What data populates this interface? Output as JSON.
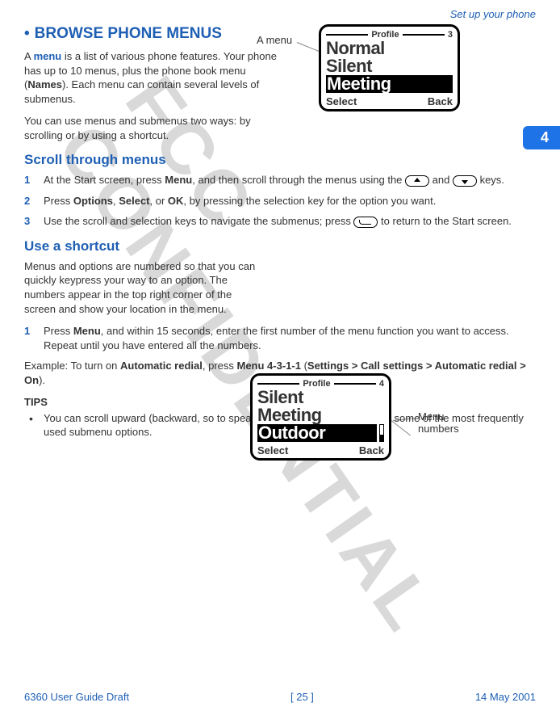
{
  "running_head": "Set up your phone",
  "tab_number": "4",
  "h1": "BROWSE PHONE MENUS",
  "intro": {
    "part1": "A ",
    "menu_word": "menu",
    "part2": " is a list of various phone features. Your phone has up to 10 menus, plus the phone book menu (",
    "names_word": "Names",
    "part3": "). Each menu can contain several levels of submenus."
  },
  "intro2": "You can use menus and submenus two ways: by scrolling or by using a shortcut.",
  "scroll_heading": "Scroll through menus",
  "scroll_steps": {
    "s1a": "At the Start screen, press ",
    "s1_menu": "Menu",
    "s1b": ", and then scroll through the menus using the ",
    "s1c": " and ",
    "s1d": " keys.",
    "s2a": "Press ",
    "s2_opt": "Options",
    "s2b": ", ",
    "s2_sel": "Select",
    "s2c": ", or ",
    "s2_ok": "OK",
    "s2d": ", by pressing the selection key for the option you want.",
    "s3a": "Use the scroll and selection keys to navigate the submenus; press ",
    "s3b": " to return to the Start screen."
  },
  "shortcut_heading": "Use a shortcut",
  "shortcut_intro": "Menus and options are numbered so that you can quickly keypress your way to an option. The numbers appear in the top right corner of the screen and show your location in the menu.",
  "shortcut_steps": {
    "s1a": "Press ",
    "s1_menu": "Menu",
    "s1b": ", and within 15 seconds, enter the first number of the menu function you want to access. Repeat until you have entered all the numbers."
  },
  "example": {
    "pre": "Example: To turn on ",
    "auto": "Automatic redial",
    "mid": ", press ",
    "combo": "Menu 4-3-1-1",
    "open": " (",
    "path": "Settings > Call settings > Automatic redial > On",
    "close": ")."
  },
  "tips_label": "TIPS",
  "tips": {
    "t1": "You can scroll upward (backward, so to speak) as well as downward to find some of the most frequently used submenu options."
  },
  "fig1": {
    "callout": "A menu",
    "title": "Profile",
    "num": "3",
    "items": [
      "Normal",
      "Silent",
      "Meeting"
    ],
    "select": "Select",
    "back": "Back"
  },
  "fig2": {
    "callout": "Menu numbers",
    "title": "Profile",
    "num": "4",
    "items": [
      "Silent",
      "Meeting",
      "Outdoor"
    ],
    "select": "Select",
    "back": "Back"
  },
  "footer": {
    "left": "6360 User Guide Draft",
    "center": "[ 25 ]",
    "right": "14 May 2001"
  }
}
